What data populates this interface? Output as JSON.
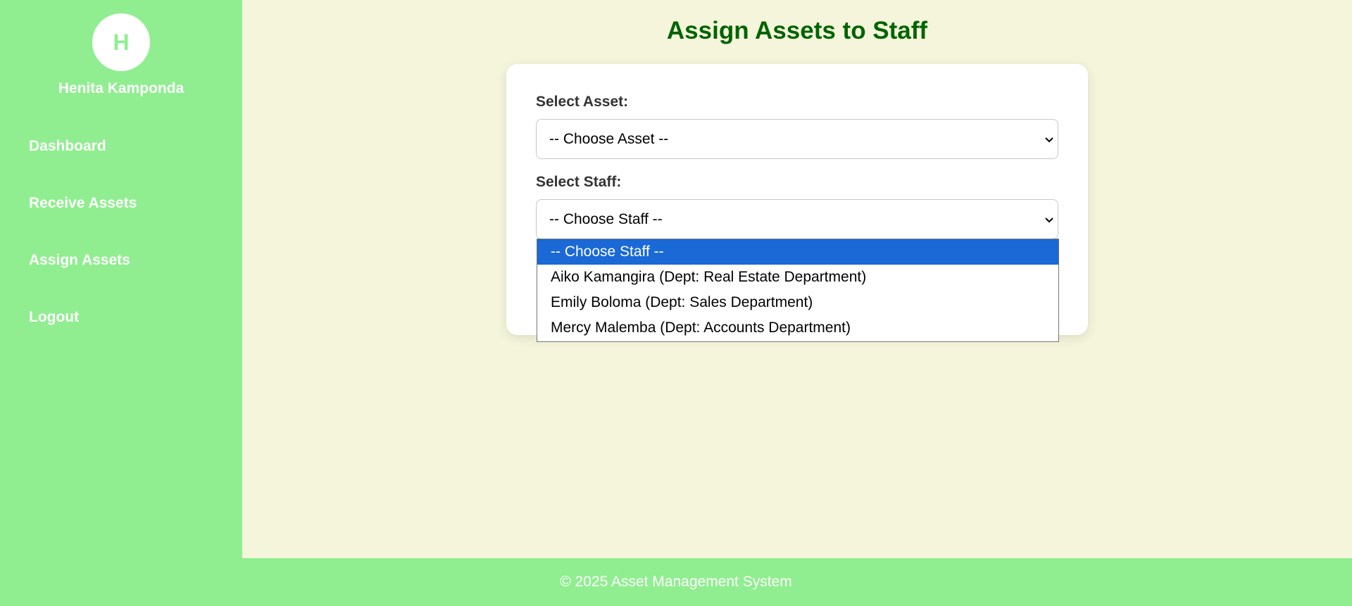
{
  "sidebar": {
    "avatar_initial": "H",
    "username": "Henita Kamponda",
    "nav": [
      {
        "label": "Dashboard"
      },
      {
        "label": "Receive Assets"
      },
      {
        "label": "Assign Assets"
      },
      {
        "label": "Logout"
      }
    ]
  },
  "main": {
    "title": "Assign Assets to Staff",
    "form": {
      "asset_label": "Select Asset:",
      "asset_value": "-- Choose Asset --",
      "staff_label": "Select Staff:",
      "staff_value": "-- Choose Staff --"
    }
  },
  "dropdown": {
    "options": [
      {
        "label": "-- Choose Staff --",
        "selected": true
      },
      {
        "label": "Aiko Kamangira (Dept: Real Estate Department)",
        "selected": false
      },
      {
        "label": "Emily Boloma (Dept: Sales Department)",
        "selected": false
      },
      {
        "label": "Mercy Malemba (Dept: Accounts Department)",
        "selected": false
      }
    ]
  },
  "footer": {
    "text": "© 2025 Asset Management System"
  },
  "colors": {
    "sidebar_bg": "#90ee90",
    "page_bg": "#f5f5dc",
    "title": "#006400",
    "selected_option_bg": "#1a69d6"
  }
}
